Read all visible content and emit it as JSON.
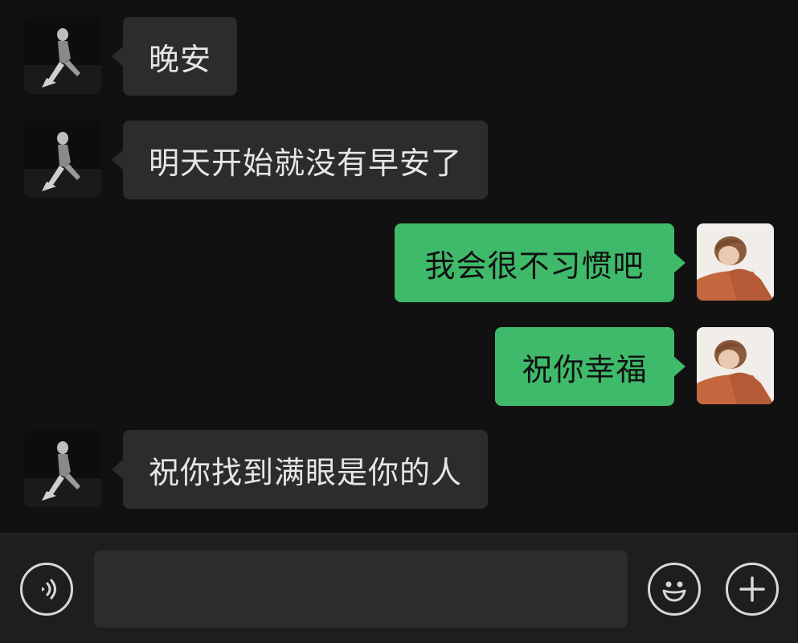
{
  "messages": [
    {
      "side": "in",
      "text": "晚安",
      "avatar": "contact-avatar"
    },
    {
      "side": "in",
      "text": "明天开始就没有早安了",
      "avatar": "contact-avatar"
    },
    {
      "side": "out",
      "text": "我会很不习惯吧",
      "avatar": "self-avatar"
    },
    {
      "side": "out",
      "text": "祝你幸福",
      "avatar": "self-avatar"
    },
    {
      "side": "in",
      "text": "祝你找到满眼是你的人",
      "avatar": "contact-avatar"
    }
  ],
  "input_bar": {
    "voice_icon": "voice-icon",
    "message_value": "",
    "emoji_icon": "emoji-icon",
    "plus_icon": "plus-icon"
  },
  "colors": {
    "background": "#111111",
    "incoming_bubble": "#2c2c2c",
    "outgoing_bubble": "#3fba6a",
    "input_bar": "#1e1e1e"
  }
}
